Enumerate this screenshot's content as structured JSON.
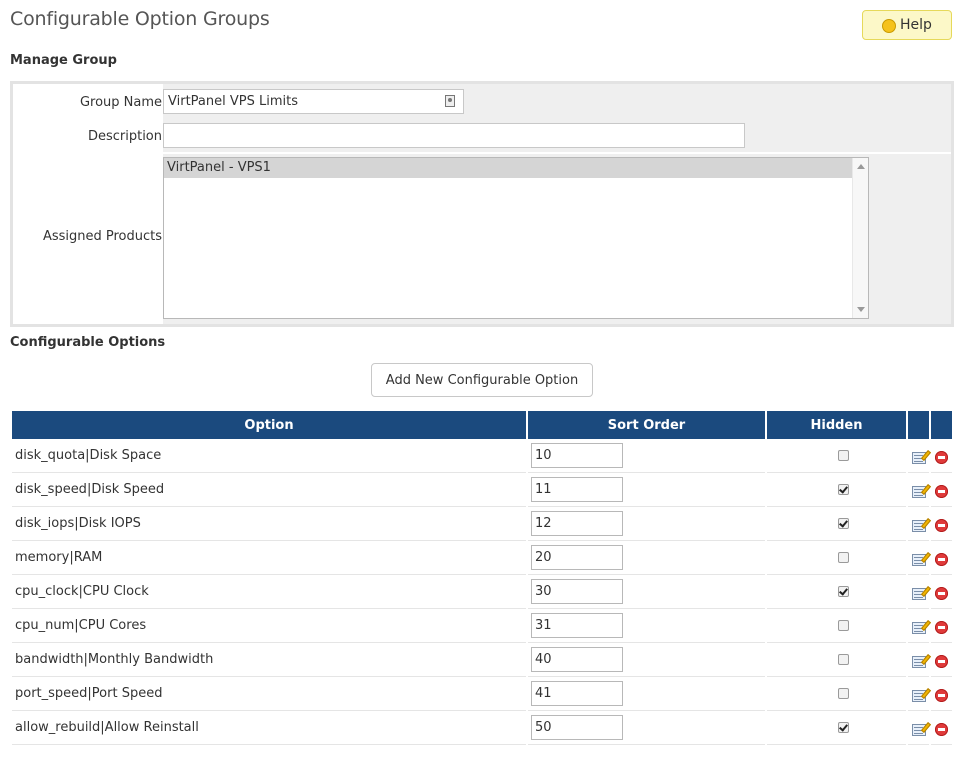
{
  "page": {
    "title": "Configurable Option Groups",
    "help_label": "Help",
    "help_icon": "lightbulb-icon"
  },
  "manage_group": {
    "heading": "Manage Group",
    "group_name_label": "Group Name",
    "group_name_value": "VirtPanel VPS Limits",
    "description_label": "Description",
    "description_value": "",
    "assigned_products_label": "Assigned Products",
    "assigned_products": [
      "VirtPanel - VPS1"
    ]
  },
  "configurable_options": {
    "heading": "Configurable Options",
    "add_button_label": "Add New Configurable Option",
    "columns": {
      "option": "Option",
      "sort_order": "Sort Order",
      "hidden": "Hidden"
    },
    "rows": [
      {
        "name": "disk_quota|Disk Space",
        "sort_order": "10",
        "hidden": false
      },
      {
        "name": "disk_speed|Disk Speed",
        "sort_order": "11",
        "hidden": true
      },
      {
        "name": "disk_iops|Disk IOPS",
        "sort_order": "12",
        "hidden": true
      },
      {
        "name": "memory|RAM",
        "sort_order": "20",
        "hidden": false
      },
      {
        "name": "cpu_clock|CPU Clock",
        "sort_order": "30",
        "hidden": true
      },
      {
        "name": "cpu_num|CPU Cores",
        "sort_order": "31",
        "hidden": false
      },
      {
        "name": "bandwidth|Monthly Bandwidth",
        "sort_order": "40",
        "hidden": false
      },
      {
        "name": "port_speed|Port Speed",
        "sort_order": "41",
        "hidden": false
      },
      {
        "name": "allow_rebuild|Allow Reinstall",
        "sort_order": "50",
        "hidden": true
      }
    ],
    "row_icons": [
      "edit-icon",
      "delete-icon"
    ]
  }
}
